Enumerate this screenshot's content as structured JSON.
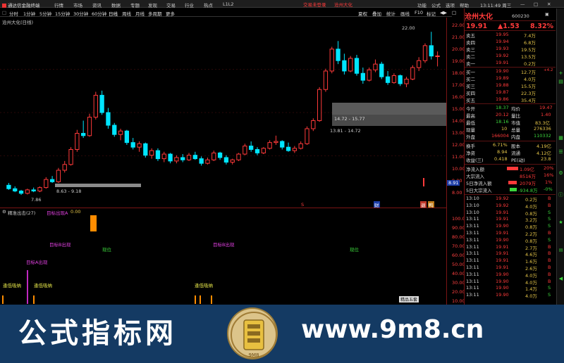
{
  "menubar": {
    "app_title": "通达信金融终端",
    "items": [
      "行情",
      "市场",
      "资讯",
      "数据",
      "专题",
      "发现",
      "交易",
      "行业",
      "热点",
      "L1L2"
    ],
    "promo": "交易未登录",
    "stock_title": "沧州大化",
    "right_items": [
      "功能",
      "公式",
      "选项",
      "帮助"
    ],
    "time": "13:11:49 周三"
  },
  "toolbar": {
    "periods": [
      "分时",
      "1分钟",
      "5分钟",
      "15分钟",
      "30分钟",
      "60分钟",
      "日线",
      "周线",
      "月线",
      "多周期",
      "更多"
    ],
    "selected": "日线",
    "right_items": [
      "夏权",
      "叠加",
      "统计",
      "画线",
      "F10",
      "标记",
      "◀▶",
      "□"
    ]
  },
  "main_chart": {
    "label": "沧州大化(日线)",
    "price_axis": [
      "22.00",
      "21.00",
      "20.00",
      "19.00",
      "18.00",
      "17.00",
      "16.00",
      "15.00",
      "14.00",
      "13.00",
      "12.00",
      "11.00",
      "10.00",
      "9.00",
      "8.00"
    ],
    "annotations": {
      "high_mark": "22.00",
      "low_mark": "7.86",
      "box_low": "8.63 - 9.18",
      "box_mid": "13.81 - 14.72",
      "box_high": "14.72 - 15.77",
      "current_tag": "8.91",
      "event_s": "S",
      "event_cai": "财",
      "event_tui": "退",
      "event_zhong": "鸭"
    }
  },
  "chart_data": {
    "type": "candlestick",
    "ylim": [
      7.5,
      22.5
    ],
    "ohlc": [
      [
        8.7,
        8.9,
        8.3,
        8.4
      ],
      [
        8.4,
        8.6,
        8.1,
        8.2
      ],
      [
        8.2,
        8.3,
        7.86,
        8.0
      ],
      [
        8.0,
        8.4,
        7.9,
        8.3
      ],
      [
        8.3,
        8.5,
        8.1,
        8.2
      ],
      [
        8.2,
        8.6,
        8.1,
        8.5
      ],
      [
        8.5,
        9.4,
        8.4,
        9.2
      ],
      [
        9.2,
        9.5,
        8.9,
        9.0
      ],
      [
        9.0,
        10.2,
        8.9,
        10.0
      ],
      [
        10.0,
        10.8,
        9.8,
        10.5
      ],
      [
        10.5,
        12.0,
        10.4,
        11.8
      ],
      [
        11.8,
        13.5,
        11.6,
        13.2
      ],
      [
        13.2,
        14.3,
        12.8,
        13.0
      ],
      [
        13.0,
        14.9,
        12.9,
        14.6
      ],
      [
        14.6,
        16.8,
        14.4,
        16.5
      ],
      [
        16.5,
        16.9,
        14.8,
        15.0
      ],
      [
        15.0,
        15.4,
        13.6,
        13.9
      ],
      [
        13.9,
        14.1,
        12.9,
        13.1
      ],
      [
        13.1,
        13.6,
        12.6,
        13.4
      ],
      [
        13.4,
        13.5,
        12.2,
        12.4
      ],
      [
        12.4,
        12.8,
        11.8,
        12.0
      ],
      [
        12.0,
        12.5,
        11.6,
        12.3
      ],
      [
        12.3,
        12.4,
        11.1,
        11.3
      ],
      [
        11.3,
        11.9,
        11.0,
        11.7
      ],
      [
        11.7,
        11.9,
        10.8,
        11.0
      ],
      [
        11.0,
        11.6,
        10.7,
        11.4
      ],
      [
        11.4,
        11.5,
        10.6,
        10.8
      ],
      [
        10.8,
        11.3,
        10.6,
        11.1
      ],
      [
        11.1,
        11.4,
        10.7,
        10.9
      ],
      [
        10.9,
        11.5,
        10.8,
        11.3
      ],
      [
        11.3,
        11.6,
        10.9,
        11.0
      ],
      [
        11.0,
        11.2,
        10.4,
        10.6
      ],
      [
        10.6,
        11.1,
        10.5,
        10.9
      ],
      [
        10.9,
        11.7,
        10.8,
        11.5
      ],
      [
        11.5,
        11.6,
        10.9,
        11.1
      ],
      [
        11.1,
        11.3,
        10.5,
        10.7
      ],
      [
        10.7,
        11.0,
        10.5,
        10.9
      ],
      [
        10.9,
        11.5,
        10.8,
        11.4
      ],
      [
        11.4,
        12.3,
        11.3,
        12.1
      ],
      [
        12.1,
        12.5,
        11.6,
        11.8
      ],
      [
        11.8,
        12.0,
        11.3,
        11.5
      ],
      [
        11.5,
        12.0,
        11.4,
        11.9
      ],
      [
        11.9,
        12.6,
        11.8,
        12.4
      ],
      [
        12.4,
        13.0,
        12.2,
        12.5
      ],
      [
        12.5,
        12.6,
        11.8,
        12.0
      ],
      [
        12.0,
        12.4,
        11.6,
        11.7
      ],
      [
        11.7,
        12.1,
        11.5,
        11.9
      ],
      [
        11.9,
        12.5,
        11.8,
        12.3
      ],
      [
        12.3,
        13.8,
        12.2,
        13.6
      ],
      [
        13.6,
        14.5,
        13.4,
        14.3
      ],
      [
        14.3,
        17.2,
        14.2,
        17.0
      ],
      [
        17.0,
        18.8,
        16.8,
        18.6
      ],
      [
        18.6,
        20.7,
        18.4,
        20.5
      ],
      [
        20.5,
        21.2,
        19.2,
        19.5
      ],
      [
        19.5,
        20.1,
        18.3,
        18.6
      ],
      [
        18.6,
        19.9,
        18.5,
        19.7
      ],
      [
        19.7,
        20.0,
        18.2,
        18.4
      ],
      [
        18.4,
        18.9,
        17.5,
        17.8
      ],
      [
        17.8,
        18.9,
        17.7,
        18.7
      ],
      [
        18.7,
        19.6,
        18.5,
        19.2
      ],
      [
        19.2,
        19.4,
        17.9,
        18.1
      ],
      [
        18.1,
        18.6,
        17.4,
        17.6
      ],
      [
        17.6,
        18.4,
        17.5,
        18.2
      ],
      [
        18.2,
        18.3,
        17.3,
        17.5
      ],
      [
        17.5,
        18.1,
        17.2,
        17.9
      ],
      [
        17.9,
        19.1,
        17.8,
        18.9
      ],
      [
        18.9,
        19.8,
        18.6,
        19.5
      ],
      [
        19.5,
        21.0,
        19.3,
        20.8
      ],
      [
        20.8,
        22.0,
        19.6,
        19.9
      ],
      [
        19.9,
        20.3,
        19.0,
        19.91
      ]
    ]
  },
  "sub_chart": {
    "label": "精准出击(27)",
    "line_label": "目标出现A",
    "line_value": "0.00",
    "markers": [
      "目标B出现",
      "现位",
      "目标B出现",
      "现位",
      "目标A出现",
      "逢低吸纳",
      "逢低吸纳",
      "逢低吸纳"
    ],
    "axis": [
      "100.00",
      "90.00",
      "80.00",
      "70.00",
      "60.00",
      "50.00",
      "40.00",
      "30.00",
      "20.00",
      "10.00"
    ],
    "footer_button": "精品五套"
  },
  "quote": {
    "name": "沧州大化",
    "code": "600230",
    "price": "19.91",
    "change": "▲1.53",
    "change_pct": "8.32%",
    "ask": [
      {
        "label": "卖五",
        "price": "19.95",
        "vol": "7.4万"
      },
      {
        "label": "卖四",
        "price": "19.94",
        "vol": "6.8万"
      },
      {
        "label": "卖三",
        "price": "19.93",
        "vol": "19.5万"
      },
      {
        "label": "卖二",
        "price": "19.92",
        "vol": "13.5万"
      },
      {
        "label": "卖一",
        "price": "19.91",
        "vol": "0.2万"
      }
    ],
    "bid": [
      {
        "label": "买一",
        "price": "19.90",
        "vol": "12.7万",
        "delta": "+4.2"
      },
      {
        "label": "买二",
        "price": "19.89",
        "vol": "4.0万",
        "delta": ""
      },
      {
        "label": "买三",
        "price": "19.88",
        "vol": "15.5万",
        "delta": ""
      },
      {
        "label": "买四",
        "price": "19.87",
        "vol": "22.3万",
        "delta": ""
      },
      {
        "label": "买五",
        "price": "19.86",
        "vol": "35.4万",
        "delta": ""
      }
    ],
    "stats": [
      {
        "l1": "今开",
        "v1": "18.37",
        "l2": "均价",
        "v2": "19.47"
      },
      {
        "l1": "最高",
        "v1": "20.12",
        "l2": "量比",
        "v2": "1.40"
      },
      {
        "l1": "最低",
        "v1": "18.16",
        "l2": "市值",
        "v2": "83.3亿"
      },
      {
        "l1": "现量",
        "v1": "10",
        "l2": "总量",
        "v2": "276336"
      },
      {
        "l1": "外盘",
        "v1": "166004",
        "l2": "内盘",
        "v2": "110332"
      }
    ],
    "stats2": [
      {
        "l1": "换手",
        "v1": "6.71%",
        "l2": "股本",
        "v2": "4.19亿"
      },
      {
        "l1": "净资",
        "v1": "8.94",
        "l2": "流通",
        "v2": "4.12亿"
      },
      {
        "l1": "收益(三)",
        "v1": "0.418",
        "l2": "PE(动)",
        "v2": "23.8"
      }
    ],
    "flow": [
      {
        "label": "净流入额",
        "value": "1.09亿",
        "pct": "20%"
      },
      {
        "label": "大宗流入",
        "value": "8516万",
        "pct": "16%"
      },
      {
        "label": "5日净流入额",
        "value": "2079万",
        "pct": "1%"
      },
      {
        "label": "5日大宗流入",
        "value": "-934.8万",
        "pct": "-0%"
      }
    ],
    "trades": [
      {
        "time": "13:10",
        "price": "19.92",
        "vol": "0.2万",
        "side": "B"
      },
      {
        "time": "13:10",
        "price": "19.92",
        "vol": "4.0万",
        "side": "B"
      },
      {
        "time": "13:10",
        "price": "19.91",
        "vol": "0.8万",
        "side": "S"
      },
      {
        "time": "13:11",
        "price": "19.91",
        "vol": "3.2万",
        "side": "S"
      },
      {
        "time": "13:11",
        "price": "19.90",
        "vol": "0.8万",
        "side": "S"
      },
      {
        "time": "13:11",
        "price": "19.91",
        "vol": "2.2万",
        "side": "B"
      },
      {
        "time": "13:11",
        "price": "19.90",
        "vol": "0.8万",
        "side": "S"
      },
      {
        "time": "13:11",
        "price": "19.91",
        "vol": "2.7万",
        "side": "B"
      },
      {
        "time": "13:11",
        "price": "19.91",
        "vol": "4.6万",
        "side": "B"
      },
      {
        "time": "13:11",
        "price": "19.91",
        "vol": "1.6万",
        "side": "B"
      },
      {
        "time": "13:11",
        "price": "19.91",
        "vol": "2.6万",
        "side": "B"
      },
      {
        "time": "13:11",
        "price": "19.90",
        "vol": "4.0万",
        "side": "B"
      },
      {
        "time": "13:11",
        "price": "19.90",
        "vol": "4.0万",
        "side": "B"
      },
      {
        "time": "13:11",
        "price": "19.90",
        "vol": "1.4万",
        "side": "S"
      },
      {
        "time": "13:11",
        "price": "19.90",
        "vol": "4.0万",
        "side": "S"
      }
    ]
  },
  "watermark": {
    "left": "公式指标网",
    "right": "www.9m8.cn",
    "seal_mark": "9M8"
  },
  "colors": {
    "up": "#ff3a3a",
    "down": "#00e5ff",
    "bg": "#000000",
    "panel_line": "#7a1414",
    "watermark_bg": "#143a63"
  }
}
